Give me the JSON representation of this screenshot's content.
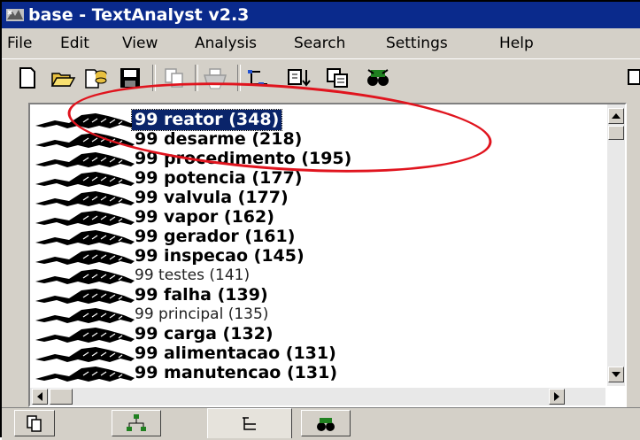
{
  "window": {
    "title": "base - TextAnalyst v2.3"
  },
  "menu": [
    "File",
    "Edit",
    "View",
    "Analysis",
    "Search",
    "Settings",
    "Help"
  ],
  "toolbar": {
    "buttons": [
      "new-document-icon",
      "open-folder-icon",
      "open-database-icon",
      "save-icon",
      "copy-icon",
      "print-icon",
      "tree-view-icon",
      "insert-icon",
      "export-icon",
      "search-binoculars-icon"
    ]
  },
  "list": {
    "items": [
      {
        "label": "99 reator (348)",
        "style": "bold",
        "selected": true
      },
      {
        "label": "99 desarme (218)",
        "style": "bold",
        "selected": false
      },
      {
        "label": "99 procedimento (195)",
        "style": "bold",
        "selected": false
      },
      {
        "label": "99 potencia (177)",
        "style": "bold",
        "selected": false
      },
      {
        "label": "99 valvula (177)",
        "style": "bold",
        "selected": false
      },
      {
        "label": "99 vapor (162)",
        "style": "bold",
        "selected": false
      },
      {
        "label": "99 gerador (161)",
        "style": "bold",
        "selected": false
      },
      {
        "label": "99 inspecao (145)",
        "style": "bold",
        "selected": false
      },
      {
        "label": "99 testes (141)",
        "style": "normal",
        "selected": false
      },
      {
        "label": "99 falha (139)",
        "style": "bold",
        "selected": false
      },
      {
        "label": "99 principal (135)",
        "style": "normal",
        "selected": false
      },
      {
        "label": "99 carga (132)",
        "style": "bold",
        "selected": false
      },
      {
        "label": "99 alimentacao (131)",
        "style": "bold",
        "selected": false
      },
      {
        "label": "99 manutencao (131)",
        "style": "bold",
        "selected": false
      }
    ]
  },
  "tabs": [
    "document-tab-icon",
    "network-tab-icon",
    "tree-tab-icon",
    "search-tab-icon"
  ],
  "colors": {
    "titlebar": "#0a2a8c",
    "selection": "#0a246a",
    "annotation": "#e0141e",
    "chrome": "#d4d0c8"
  }
}
